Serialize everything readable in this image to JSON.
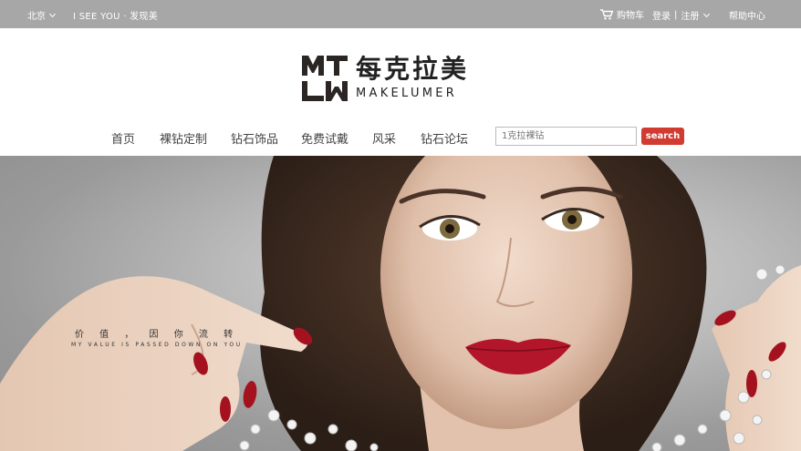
{
  "topbar": {
    "city": "北京",
    "slogan": "I SEE YOU · 发现美",
    "cart": "购物车",
    "login": "登录",
    "separator": "|",
    "register": "注册",
    "help": "帮助中心"
  },
  "logo": {
    "mark_letters": "MLW",
    "name_cn": "每克拉美",
    "name_en": "MAKELUMER"
  },
  "nav": {
    "items": [
      "首页",
      "裸钻定制",
      "钻石饰品",
      "免费试戴",
      "风采",
      "钻石论坛"
    ]
  },
  "search": {
    "placeholder": "1克拉裸钻",
    "button_label": "search"
  },
  "hero": {
    "tagline_cn": "价 值 ， 因 你 流 转",
    "tagline_en": "MY VALUE IS PASSED DOWN ON YOU"
  },
  "colors": {
    "topbar_bg": "#a7a7a7",
    "accent": "#d23b32",
    "lipstick": "#b3152a"
  }
}
